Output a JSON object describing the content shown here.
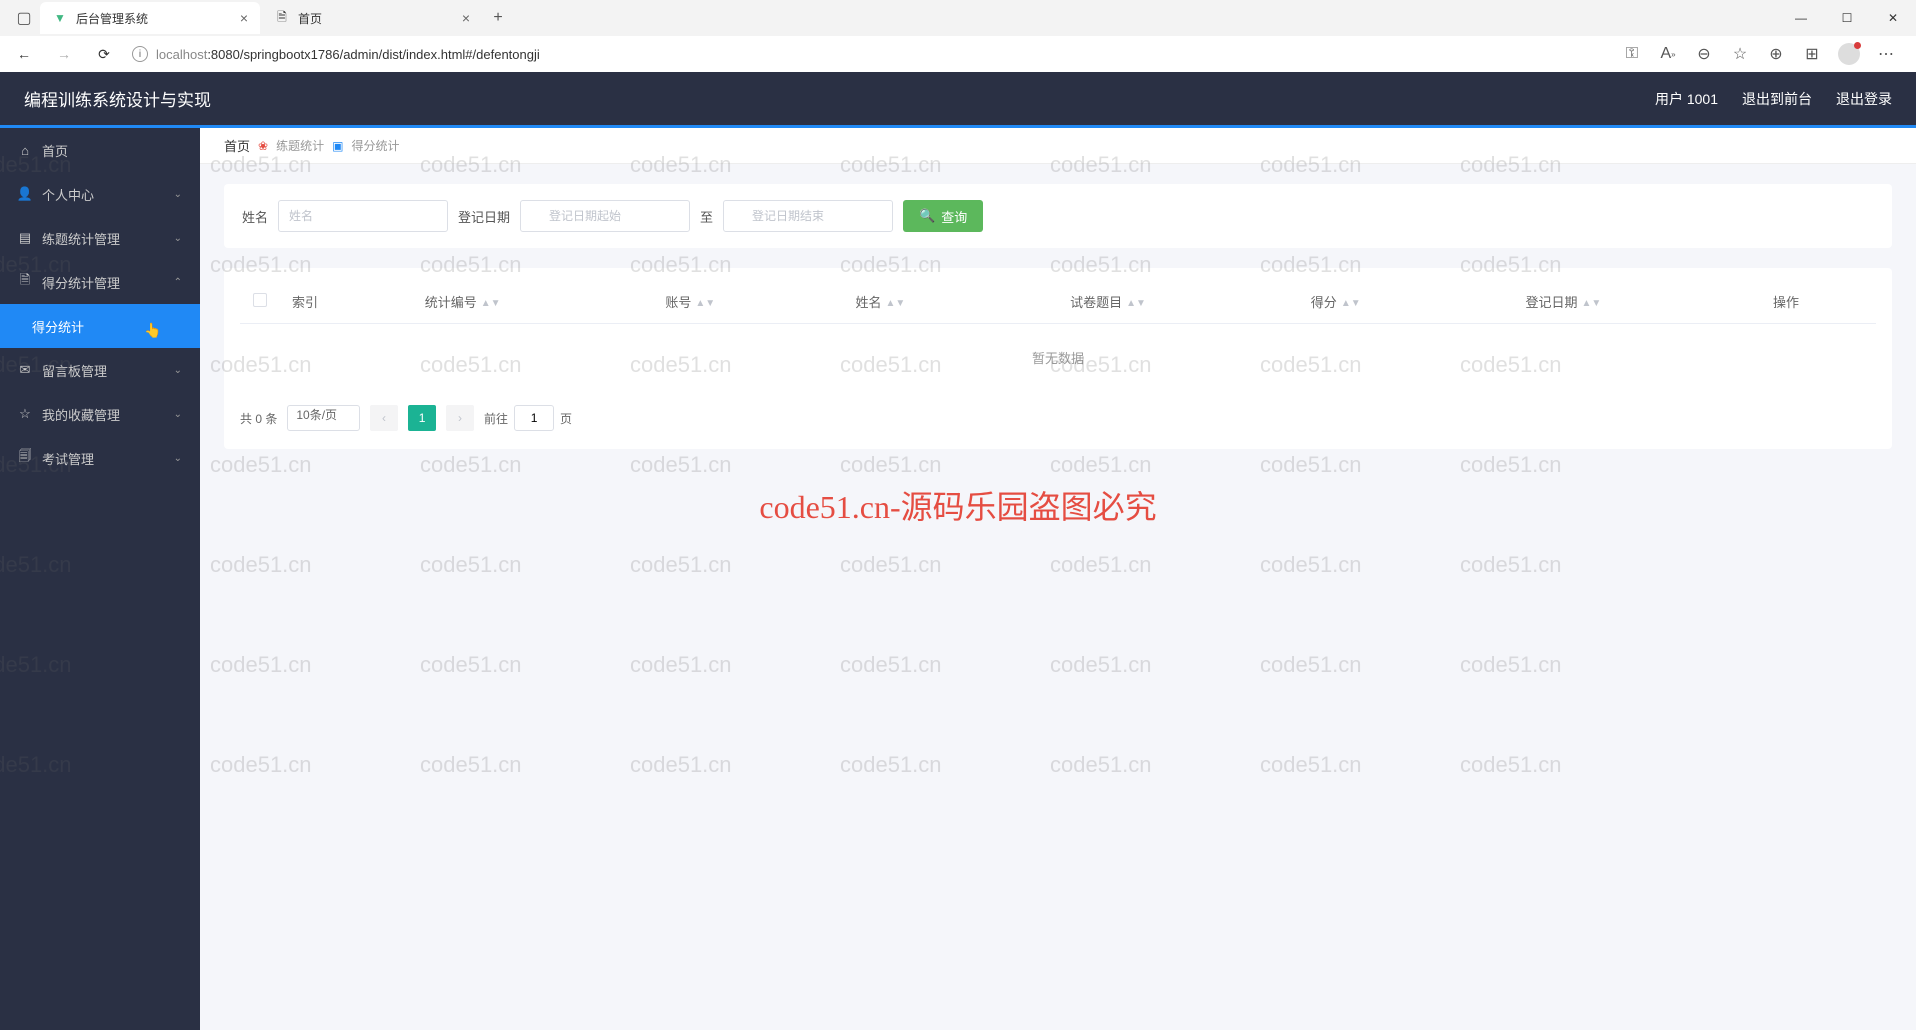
{
  "browser": {
    "tabs": [
      {
        "title": "后台管理系统",
        "icon": "vue",
        "active": true
      },
      {
        "title": "首页",
        "icon": "page",
        "active": false
      }
    ],
    "url_host": "localhost",
    "url_path": ":8080/springbootx1786/admin/dist/index.html#/defentongji",
    "window_controls": {
      "min": "—",
      "max": "☐",
      "close": "✕"
    }
  },
  "header": {
    "title": "编程训练系统设计与实现",
    "user": "用户 1001",
    "to_front": "退出到前台",
    "logout": "退出登录"
  },
  "sidebar": {
    "items": [
      {
        "label": "首页",
        "icon": "home",
        "expandable": false
      },
      {
        "label": "个人中心",
        "icon": "user",
        "expandable": true,
        "open": false
      },
      {
        "label": "练题统计管理",
        "icon": "list",
        "expandable": true,
        "open": false
      },
      {
        "label": "得分统计管理",
        "icon": "doc",
        "expandable": true,
        "open": true,
        "children": [
          {
            "label": "得分统计",
            "active": true
          }
        ]
      },
      {
        "label": "留言板管理",
        "icon": "message",
        "expandable": true,
        "open": false
      },
      {
        "label": "我的收藏管理",
        "icon": "star",
        "expandable": true,
        "open": false
      },
      {
        "label": "考试管理",
        "icon": "exam",
        "expandable": true,
        "open": false
      }
    ]
  },
  "breadcrumb": {
    "home": "首页",
    "items": [
      "练题统计",
      "得分统计"
    ]
  },
  "filter": {
    "name_label": "姓名",
    "name_placeholder": "姓名",
    "date_label": "登记日期",
    "date_start_placeholder": "登记日期起始",
    "date_sep": "至",
    "date_end_placeholder": "登记日期结束",
    "search_label": "查询"
  },
  "table": {
    "columns": [
      "索引",
      "统计编号",
      "账号",
      "姓名",
      "试卷题目",
      "得分",
      "登记日期",
      "操作"
    ],
    "empty": "暂无数据"
  },
  "pagination": {
    "total_text": "共 0 条",
    "page_size_text": "10条/页",
    "current": "1",
    "goto_label": "前往",
    "goto_value": "1",
    "page_suffix": "页"
  },
  "watermark": {
    "text": "code51.cn",
    "red_text": "code51.cn-源码乐园盗图必究"
  }
}
